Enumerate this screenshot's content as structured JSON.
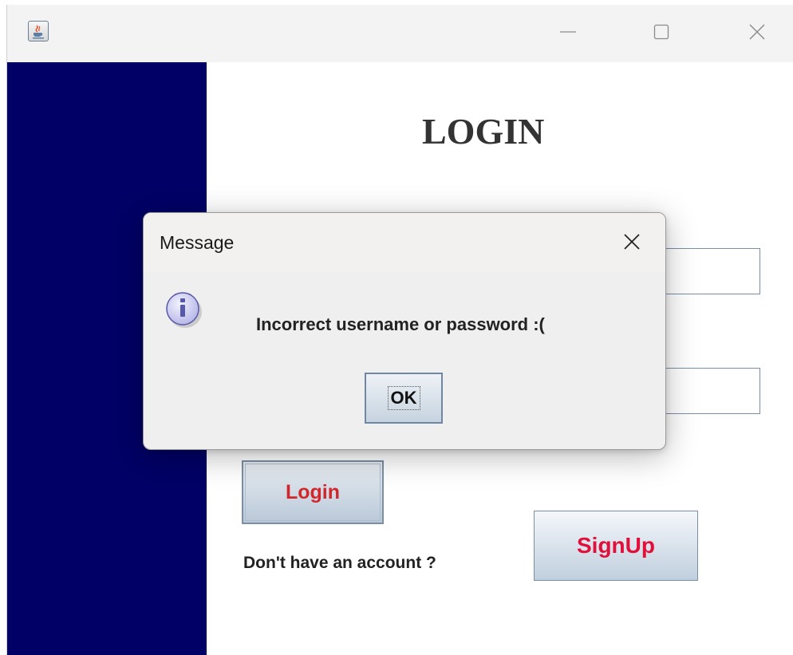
{
  "window": {
    "app_icon": "java-coffee-icon",
    "controls": [
      "minimize-icon",
      "maximize-icon",
      "close-icon"
    ]
  },
  "colors": {
    "sidebar": "#000066",
    "login_button_text": "#d1272b",
    "signup_button_text": "#e0103a",
    "title_text": "#333333"
  },
  "form": {
    "title": "LOGIN",
    "username_value": "",
    "password_value": "",
    "login_label": "Login",
    "no_account_text": "Don't have an account ?",
    "signup_label": "SignUp"
  },
  "dialog": {
    "title": "Message",
    "icon": "information-icon",
    "message": "Incorrect username or password :(",
    "ok_label": "OK"
  }
}
